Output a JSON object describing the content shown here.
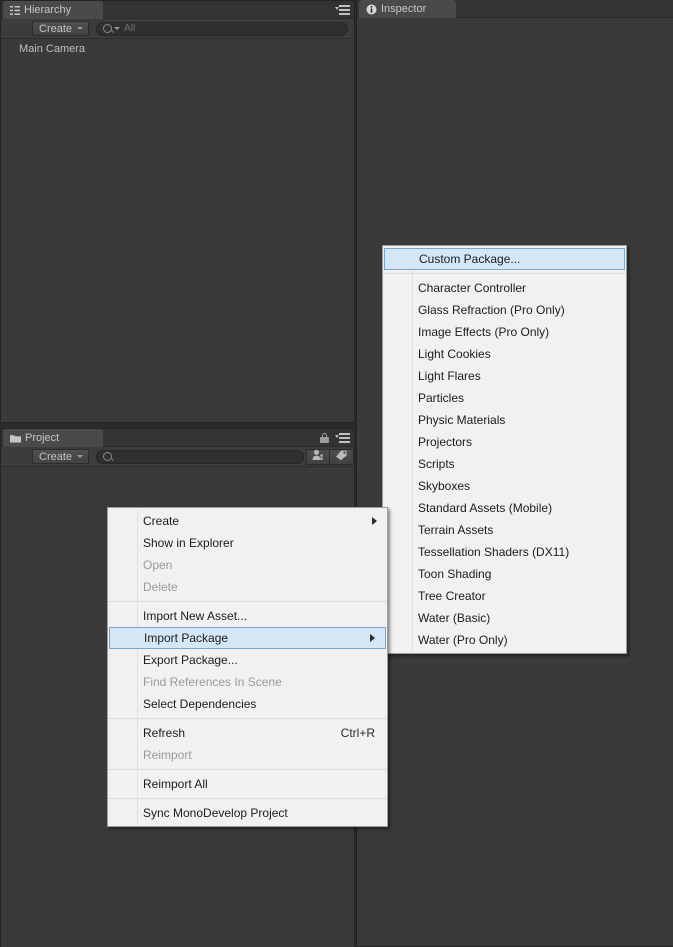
{
  "theme": {
    "editor_bg": "#2b2b2b",
    "panel_bg": "#3a3a3a",
    "tab_bg": "#4a4a4a",
    "menu_bg": "#f1f1f1",
    "menu_highlight": "#d4e7f7",
    "menu_highlight_border": "#7ba7cf",
    "text": "#b4b4b4",
    "menu_text": "#1c1c1c",
    "menu_disabled_text": "#9a9a9a"
  },
  "hierarchy_panel": {
    "tab_label": "Hierarchy",
    "tab_icon": "hierarchy-icon",
    "create_label": "Create",
    "search_placeholder": "All",
    "search_value": "",
    "search_icon": "search-icon",
    "menu_icon": "panel-menu-icon",
    "items": [
      {
        "label": "Main Camera"
      }
    ]
  },
  "inspector_panel": {
    "tab_label": "Inspector",
    "tab_icon": "info-icon"
  },
  "project_panel": {
    "tab_label": "Project",
    "tab_icon": "folder-icon",
    "create_label": "Create",
    "search_placeholder": "",
    "search_value": "",
    "search_icon": "search-icon",
    "lock_icon": "lock-icon",
    "menu_icon": "panel-menu-icon",
    "filter_buttons": [
      {
        "icon": "filter-by-type-icon"
      },
      {
        "icon": "filter-by-label-icon"
      }
    ]
  },
  "context_menu": {
    "groups": [
      {
        "items": [
          {
            "label": "Create",
            "disabled": false,
            "submenu": true,
            "selected": false,
            "shortcut": ""
          },
          {
            "label": "Show in Explorer",
            "disabled": false,
            "submenu": false,
            "selected": false,
            "shortcut": ""
          },
          {
            "label": "Open",
            "disabled": true,
            "submenu": false,
            "selected": false,
            "shortcut": ""
          },
          {
            "label": "Delete",
            "disabled": true,
            "submenu": false,
            "selected": false,
            "shortcut": ""
          }
        ]
      },
      {
        "items": [
          {
            "label": "Import New Asset...",
            "disabled": false,
            "submenu": false,
            "selected": false,
            "shortcut": ""
          },
          {
            "label": "Import Package",
            "disabled": false,
            "submenu": true,
            "selected": true,
            "shortcut": ""
          },
          {
            "label": "Export Package...",
            "disabled": false,
            "submenu": false,
            "selected": false,
            "shortcut": ""
          },
          {
            "label": "Find References In Scene",
            "disabled": true,
            "submenu": false,
            "selected": false,
            "shortcut": ""
          },
          {
            "label": "Select Dependencies",
            "disabled": false,
            "submenu": false,
            "selected": false,
            "shortcut": ""
          }
        ]
      },
      {
        "items": [
          {
            "label": "Refresh",
            "disabled": false,
            "submenu": false,
            "selected": false,
            "shortcut": "Ctrl+R"
          },
          {
            "label": "Reimport",
            "disabled": true,
            "submenu": false,
            "selected": false,
            "shortcut": ""
          }
        ]
      },
      {
        "items": [
          {
            "label": "Reimport All",
            "disabled": false,
            "submenu": false,
            "selected": false,
            "shortcut": ""
          }
        ]
      },
      {
        "items": [
          {
            "label": "Sync MonoDevelop Project",
            "disabled": false,
            "submenu": false,
            "selected": false,
            "shortcut": ""
          }
        ]
      }
    ]
  },
  "import_package_submenu": {
    "groups": [
      {
        "items": [
          {
            "label": "Custom Package...",
            "disabled": false,
            "selected": true
          }
        ]
      },
      {
        "items": [
          {
            "label": "Character Controller",
            "disabled": false,
            "selected": false
          },
          {
            "label": "Glass Refraction (Pro Only)",
            "disabled": false,
            "selected": false
          },
          {
            "label": "Image Effects (Pro Only)",
            "disabled": false,
            "selected": false
          },
          {
            "label": "Light Cookies",
            "disabled": false,
            "selected": false
          },
          {
            "label": "Light Flares",
            "disabled": false,
            "selected": false
          },
          {
            "label": "Particles",
            "disabled": false,
            "selected": false
          },
          {
            "label": "Physic Materials",
            "disabled": false,
            "selected": false
          },
          {
            "label": "Projectors",
            "disabled": false,
            "selected": false
          },
          {
            "label": "Scripts",
            "disabled": false,
            "selected": false
          },
          {
            "label": "Skyboxes",
            "disabled": false,
            "selected": false
          },
          {
            "label": "Standard Assets (Mobile)",
            "disabled": false,
            "selected": false
          },
          {
            "label": "Terrain Assets",
            "disabled": false,
            "selected": false
          },
          {
            "label": "Tessellation Shaders (DX11)",
            "disabled": false,
            "selected": false
          },
          {
            "label": "Toon Shading",
            "disabled": false,
            "selected": false
          },
          {
            "label": "Tree Creator",
            "disabled": false,
            "selected": false
          },
          {
            "label": "Water (Basic)",
            "disabled": false,
            "selected": false
          },
          {
            "label": "Water (Pro Only)",
            "disabled": false,
            "selected": false
          }
        ]
      }
    ]
  }
}
